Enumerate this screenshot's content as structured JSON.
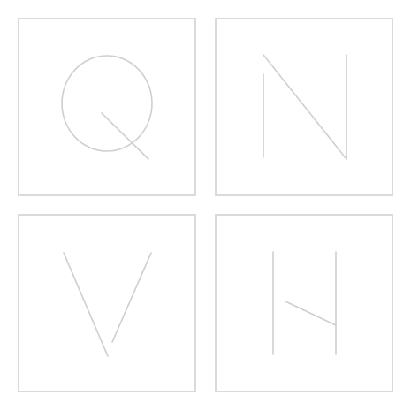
{
  "palette": {
    "background": "#ffffff",
    "tile_border": "#dadada",
    "glyph_stroke": "#cfcfcf"
  },
  "tiles": [
    {
      "glyph": "Q",
      "icon": "letter-q-glyph"
    },
    {
      "glyph": "N",
      "icon": "letter-n-glyph"
    },
    {
      "glyph": "V",
      "icon": "letter-v-glyph"
    },
    {
      "glyph": "partial-h",
      "icon": "letter-h-partial-glyph"
    }
  ]
}
